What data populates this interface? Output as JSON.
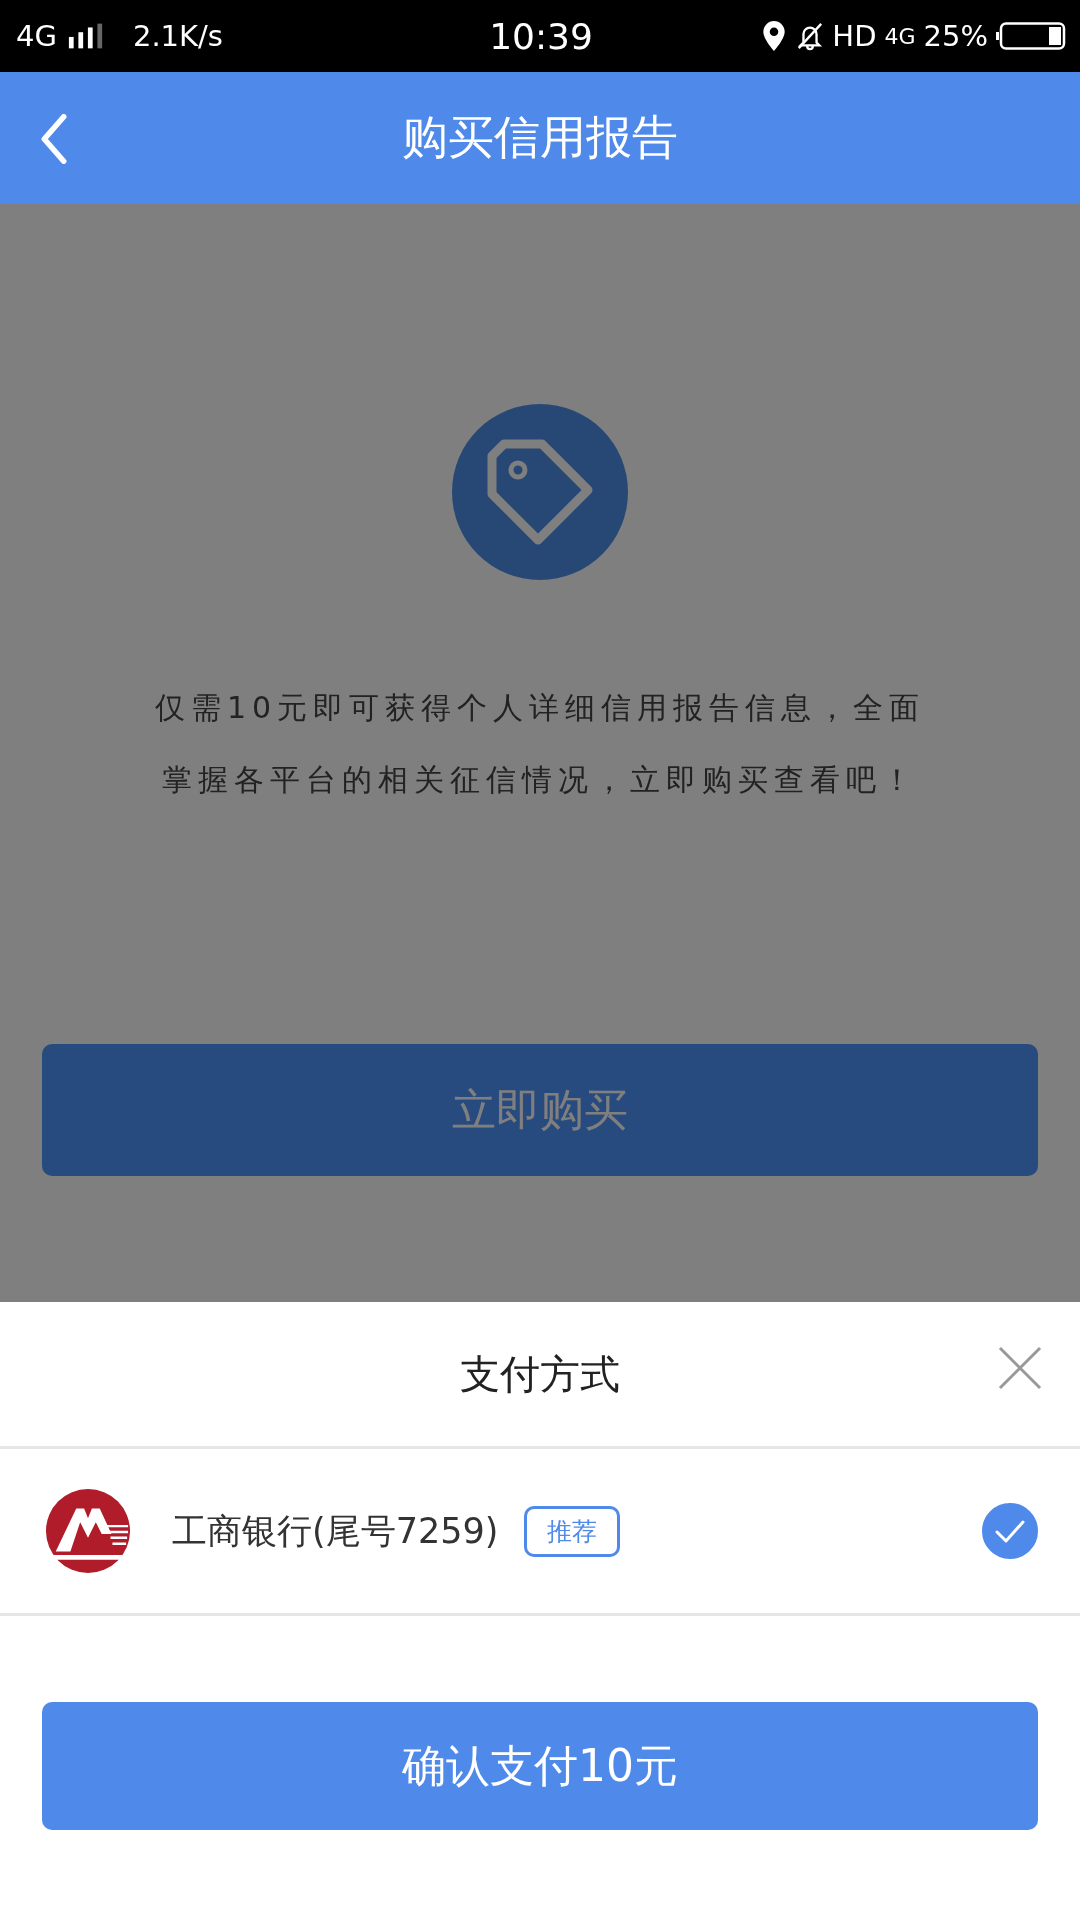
{
  "status_bar": {
    "network": "4G",
    "speed": "2.1K/s",
    "time": "10:39",
    "hd": "HD",
    "network_2": "4G",
    "battery": "25%"
  },
  "header": {
    "title": "购买信用报告"
  },
  "product": {
    "description": "仅需10元即可获得个人详细信用报告信息，全面掌握各平台的相关征信情况，立即购买查看吧！",
    "buy_button": "立即购买"
  },
  "payment_sheet": {
    "title": "支付方式",
    "methods": [
      {
        "name": "工商银行(尾号7259)",
        "tag": "推荐",
        "selected": true
      }
    ],
    "confirm_button": "确认支付10元"
  }
}
